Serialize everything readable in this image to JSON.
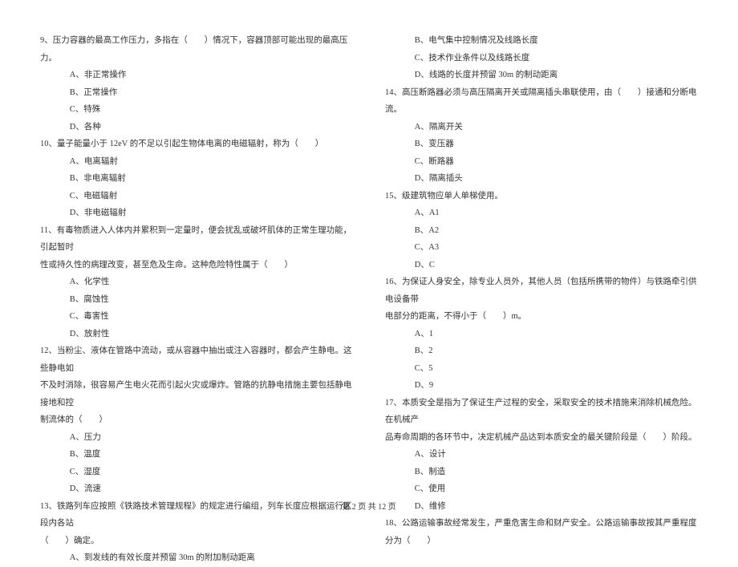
{
  "left": {
    "q9": {
      "text": "9、压力容器的最高工作压力，多指在（　　）情况下，容器顶部可能出现的最高压力。",
      "opts": [
        "A、非正常操作",
        "B、正常操作",
        "C、特殊",
        "D、各种"
      ]
    },
    "q10": {
      "text": "10、量子能量小于 12eV 的不足以引起生物体电离的电磁辐射，称为（　　）",
      "opts": [
        "A、电离辐射",
        "B、非电离辐射",
        "C、电磁辐射",
        "D、非电磁辐射"
      ]
    },
    "q11": {
      "text1": "11、有毒物质进入人体内并累积到一定量时，便会扰乱或破坏肌体的正常生理功能，引起暂时",
      "text2": "性或持久性的病理改变，甚至危及生命。这种危险特性属于（　　）",
      "opts": [
        "A、化学性",
        "B、腐蚀性",
        "C、毒害性",
        "D、放射性"
      ]
    },
    "q12": {
      "text1": "12、当粉尘、液体在管路中流动，或从容器中抽出或注入容器时，都会产生静电。这些静电如",
      "text2": "不及时消除，很容易产生电火花而引起火灾或爆炸。管路的抗静电措施主要包括静电接地和控",
      "text3": "制流体的（　　）",
      "opts": [
        "A、压力",
        "B、温度",
        "C、湿度",
        "D、流速"
      ]
    },
    "q13": {
      "text1": "13、铁路列车应按照《铁路技术管理规程》的规定进行编组，列车长度应根据运行区段内各站",
      "text2": "（　　）确定。",
      "opt_a": "A、到发线的有效长度并预留 30m 的附加制动距离"
    }
  },
  "right": {
    "q13_opts": [
      "B、电气集中控制情况及线路长度",
      "C、技术作业条件以及线路长度",
      "D、线路的长度并预留 30m 的制动距离"
    ],
    "q14": {
      "text": "14、高压断路器必须与高压隔离开关或隔离插头串联使用，由（　　）接通和分断电流。",
      "opts": [
        "A、隔离开关",
        "B、变压器",
        "C、断路器",
        "D、隔离插头"
      ]
    },
    "q15": {
      "text": "15、级建筑物应单人单梯使用。",
      "opts": [
        "A、A1",
        "B、A2",
        "C、A3",
        "D、C"
      ]
    },
    "q16": {
      "text1": "16、为保证人身安全，除专业人员外，其他人员（包括所携带的物件）与铁路牵引供电设备带",
      "text2": "电部分的距离，不得小于（　　）m。",
      "opts": [
        "A、1",
        "B、2",
        "C、5",
        "D、9"
      ]
    },
    "q17": {
      "text1": "17、本质安全是指为了保证生产过程的安全，采取安全的技术措施来消除机械危险。在机械产",
      "text2": "品寿命周期的各环节中，决定机械产品达到本质安全的最关键阶段是（　　）阶段。",
      "opts": [
        "A、设计",
        "B、制造",
        "C、使用",
        "D、维修"
      ]
    },
    "q18": {
      "text": "18、公路运输事故经常发生，严重危害生命和财产安全。公路运输事故按其严重程度分为（　　）"
    }
  },
  "footer": "第 2 页 共 12 页"
}
